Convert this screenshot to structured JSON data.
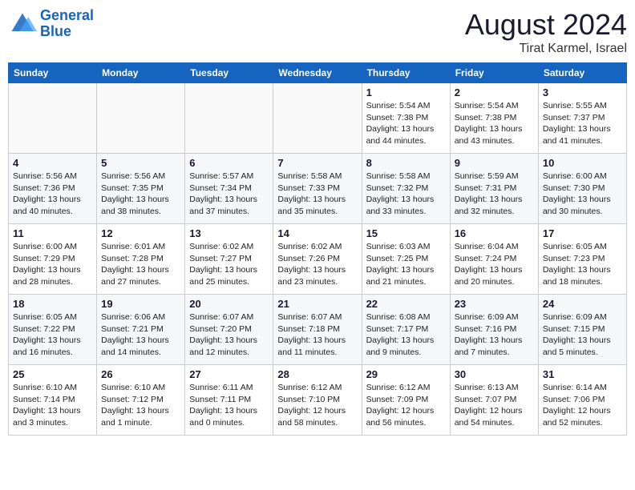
{
  "header": {
    "logo_line1": "General",
    "logo_line2": "Blue",
    "month_title": "August 2024",
    "location": "Tirat Karmel, Israel"
  },
  "days_of_week": [
    "Sunday",
    "Monday",
    "Tuesday",
    "Wednesday",
    "Thursday",
    "Friday",
    "Saturday"
  ],
  "weeks": [
    [
      {
        "day": "",
        "info": ""
      },
      {
        "day": "",
        "info": ""
      },
      {
        "day": "",
        "info": ""
      },
      {
        "day": "",
        "info": ""
      },
      {
        "day": "1",
        "info": "Sunrise: 5:54 AM\nSunset: 7:38 PM\nDaylight: 13 hours\nand 44 minutes."
      },
      {
        "day": "2",
        "info": "Sunrise: 5:54 AM\nSunset: 7:38 PM\nDaylight: 13 hours\nand 43 minutes."
      },
      {
        "day": "3",
        "info": "Sunrise: 5:55 AM\nSunset: 7:37 PM\nDaylight: 13 hours\nand 41 minutes."
      }
    ],
    [
      {
        "day": "4",
        "info": "Sunrise: 5:56 AM\nSunset: 7:36 PM\nDaylight: 13 hours\nand 40 minutes."
      },
      {
        "day": "5",
        "info": "Sunrise: 5:56 AM\nSunset: 7:35 PM\nDaylight: 13 hours\nand 38 minutes."
      },
      {
        "day": "6",
        "info": "Sunrise: 5:57 AM\nSunset: 7:34 PM\nDaylight: 13 hours\nand 37 minutes."
      },
      {
        "day": "7",
        "info": "Sunrise: 5:58 AM\nSunset: 7:33 PM\nDaylight: 13 hours\nand 35 minutes."
      },
      {
        "day": "8",
        "info": "Sunrise: 5:58 AM\nSunset: 7:32 PM\nDaylight: 13 hours\nand 33 minutes."
      },
      {
        "day": "9",
        "info": "Sunrise: 5:59 AM\nSunset: 7:31 PM\nDaylight: 13 hours\nand 32 minutes."
      },
      {
        "day": "10",
        "info": "Sunrise: 6:00 AM\nSunset: 7:30 PM\nDaylight: 13 hours\nand 30 minutes."
      }
    ],
    [
      {
        "day": "11",
        "info": "Sunrise: 6:00 AM\nSunset: 7:29 PM\nDaylight: 13 hours\nand 28 minutes."
      },
      {
        "day": "12",
        "info": "Sunrise: 6:01 AM\nSunset: 7:28 PM\nDaylight: 13 hours\nand 27 minutes."
      },
      {
        "day": "13",
        "info": "Sunrise: 6:02 AM\nSunset: 7:27 PM\nDaylight: 13 hours\nand 25 minutes."
      },
      {
        "day": "14",
        "info": "Sunrise: 6:02 AM\nSunset: 7:26 PM\nDaylight: 13 hours\nand 23 minutes."
      },
      {
        "day": "15",
        "info": "Sunrise: 6:03 AM\nSunset: 7:25 PM\nDaylight: 13 hours\nand 21 minutes."
      },
      {
        "day": "16",
        "info": "Sunrise: 6:04 AM\nSunset: 7:24 PM\nDaylight: 13 hours\nand 20 minutes."
      },
      {
        "day": "17",
        "info": "Sunrise: 6:05 AM\nSunset: 7:23 PM\nDaylight: 13 hours\nand 18 minutes."
      }
    ],
    [
      {
        "day": "18",
        "info": "Sunrise: 6:05 AM\nSunset: 7:22 PM\nDaylight: 13 hours\nand 16 minutes."
      },
      {
        "day": "19",
        "info": "Sunrise: 6:06 AM\nSunset: 7:21 PM\nDaylight: 13 hours\nand 14 minutes."
      },
      {
        "day": "20",
        "info": "Sunrise: 6:07 AM\nSunset: 7:20 PM\nDaylight: 13 hours\nand 12 minutes."
      },
      {
        "day": "21",
        "info": "Sunrise: 6:07 AM\nSunset: 7:18 PM\nDaylight: 13 hours\nand 11 minutes."
      },
      {
        "day": "22",
        "info": "Sunrise: 6:08 AM\nSunset: 7:17 PM\nDaylight: 13 hours\nand 9 minutes."
      },
      {
        "day": "23",
        "info": "Sunrise: 6:09 AM\nSunset: 7:16 PM\nDaylight: 13 hours\nand 7 minutes."
      },
      {
        "day": "24",
        "info": "Sunrise: 6:09 AM\nSunset: 7:15 PM\nDaylight: 13 hours\nand 5 minutes."
      }
    ],
    [
      {
        "day": "25",
        "info": "Sunrise: 6:10 AM\nSunset: 7:14 PM\nDaylight: 13 hours\nand 3 minutes."
      },
      {
        "day": "26",
        "info": "Sunrise: 6:10 AM\nSunset: 7:12 PM\nDaylight: 13 hours\nand 1 minute."
      },
      {
        "day": "27",
        "info": "Sunrise: 6:11 AM\nSunset: 7:11 PM\nDaylight: 13 hours\nand 0 minutes."
      },
      {
        "day": "28",
        "info": "Sunrise: 6:12 AM\nSunset: 7:10 PM\nDaylight: 12 hours\nand 58 minutes."
      },
      {
        "day": "29",
        "info": "Sunrise: 6:12 AM\nSunset: 7:09 PM\nDaylight: 12 hours\nand 56 minutes."
      },
      {
        "day": "30",
        "info": "Sunrise: 6:13 AM\nSunset: 7:07 PM\nDaylight: 12 hours\nand 54 minutes."
      },
      {
        "day": "31",
        "info": "Sunrise: 6:14 AM\nSunset: 7:06 PM\nDaylight: 12 hours\nand 52 minutes."
      }
    ]
  ]
}
